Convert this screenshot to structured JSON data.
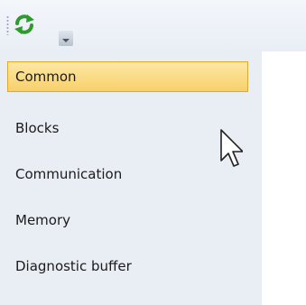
{
  "toolbar": {
    "refresh_icon": "refresh-icon",
    "dropdown_icon": "dropdown-arrow-icon"
  },
  "nav": {
    "items": [
      {
        "label": "Common",
        "selected": true
      },
      {
        "label": "Blocks",
        "selected": false
      },
      {
        "label": "Communication",
        "selected": false
      },
      {
        "label": "Memory",
        "selected": false
      },
      {
        "label": "Diagnostic buffer",
        "selected": false
      }
    ]
  },
  "colors": {
    "selection_fill": "#f8d06b",
    "selection_border": "#e1a730",
    "panel_bg": "#e9edf4",
    "refresh_green": "#2e9b2e"
  }
}
